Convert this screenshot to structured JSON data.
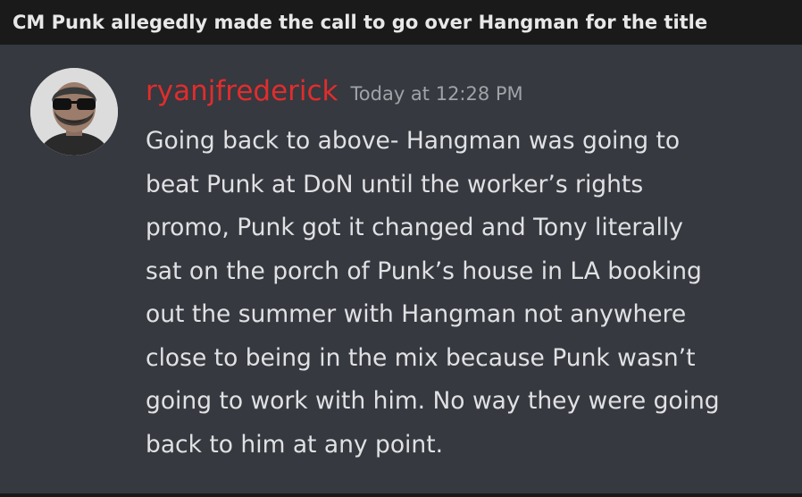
{
  "post": {
    "title": "CM Punk allegedly made the call to go over Hangman for the title"
  },
  "message": {
    "avatar_icon": "user-avatar-photo",
    "username": "ryanjfrederick",
    "username_color": "#e02d2d",
    "timestamp": "Today at 12:28 PM",
    "lines": [
      "Going back to above- Hangman was going to",
      "beat Punk at DoN until the worker’s rights",
      "promo, Punk got it changed and Tony literally",
      "sat on the porch of Punk’s house in LA booking",
      "out the summer with Hangman not anywhere",
      "close to being in the mix because Punk wasn’t",
      "going to work with him. No way they were going",
      "back to him at any point."
    ]
  },
  "colors": {
    "page_background": "#1a1a1b",
    "chat_background": "#36393f",
    "message_text": "#e0e1e4",
    "timestamp_text": "#a0a3a8"
  }
}
